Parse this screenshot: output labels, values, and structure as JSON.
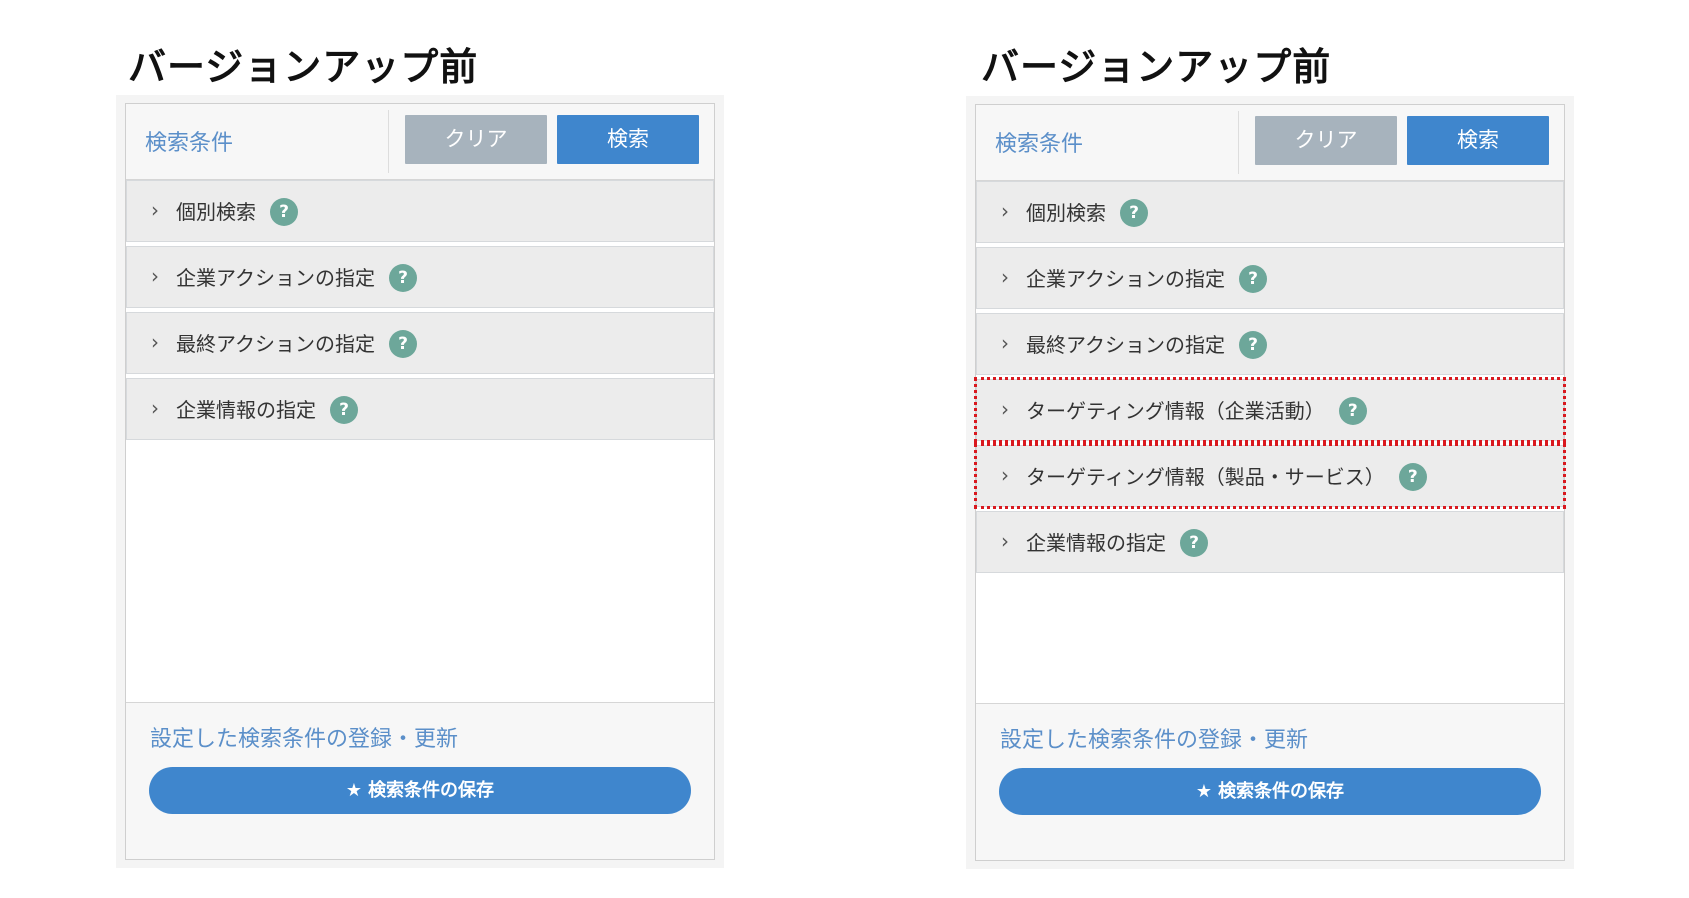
{
  "left": {
    "heading": "バージョンアップ前",
    "header_label": "検索条件",
    "clear_label": "クリア",
    "search_label": "検索",
    "items": [
      {
        "label": "個別検索",
        "help": "?"
      },
      {
        "label": "企業アクションの指定",
        "help": "?"
      },
      {
        "label": "最終アクションの指定",
        "help": "?"
      },
      {
        "label": "企業情報の指定",
        "help": "?"
      }
    ],
    "footer_link": "設定した検索条件の登録・更新",
    "save_label": "検索条件の保存"
  },
  "right": {
    "heading": "バージョンアップ前",
    "header_label": "検索条件",
    "clear_label": "クリア",
    "search_label": "検索",
    "items": [
      {
        "label": "個別検索",
        "help": "?"
      },
      {
        "label": "企業アクションの指定",
        "help": "?"
      },
      {
        "label": "最終アクションの指定",
        "help": "?"
      },
      {
        "label": "ターゲティング情報（企業活動）",
        "help": "?"
      },
      {
        "label": "ターゲティング情報（製品・サービス）",
        "help": "?"
      },
      {
        "label": "企業情報の指定",
        "help": "?"
      }
    ],
    "footer_link": "設定した検索条件の登録・更新",
    "save_label": "検索条件の保存"
  },
  "icons": {
    "chevron": "chevron-right-icon",
    "help": "question-circle-icon",
    "star": "star-icon"
  },
  "colors": {
    "accent": "#3f86cd",
    "clear_button": "#a7b3bd",
    "link": "#5b8fc9",
    "help_icon": "#6da79a",
    "highlight_border": "#d9191f"
  }
}
